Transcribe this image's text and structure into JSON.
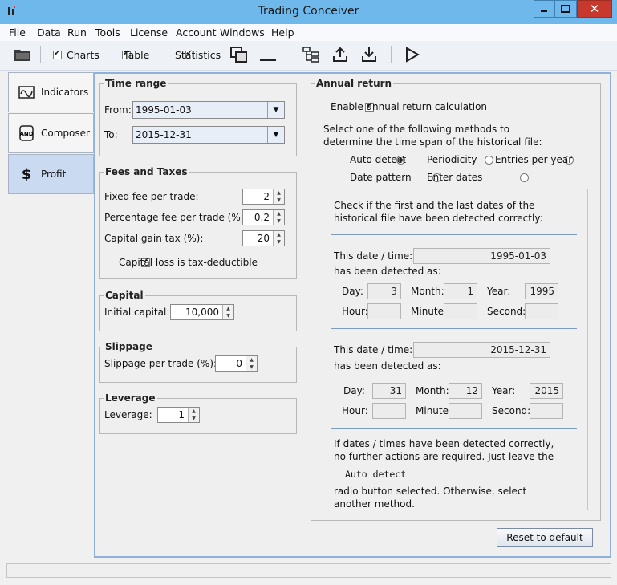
{
  "window": {
    "title": "Trading Conceiver",
    "minimize": "▁",
    "maximize": "□",
    "close": "✕"
  },
  "menu": [
    "File",
    "Data",
    "Run",
    "Tools",
    "License",
    "Account",
    "Windows",
    "Help"
  ],
  "toolbar": {
    "charts_label": "Charts",
    "table_label": "Table",
    "statistics_label": "Statistics",
    "charts_checked": true,
    "table_checked": true,
    "statistics_checked": true,
    "icons": [
      "folder-icon",
      "copy-windows-icon",
      "minimize-line-icon",
      "tree-icon",
      "upload-icon",
      "download-icon",
      "play-icon"
    ]
  },
  "tabs": [
    {
      "label": "Indicators",
      "icon": "wave-icon",
      "active": false
    },
    {
      "label": "Composer",
      "icon": "and-gate-icon",
      "active": false
    },
    {
      "label": "Profit",
      "icon": "dollar-icon",
      "active": true
    }
  ],
  "time_range": {
    "legend": "Time range",
    "from_label": "From:",
    "from_value": "1995-01-03",
    "to_label": "To:",
    "to_value": "2015-12-31"
  },
  "fees": {
    "legend": "Fees and Taxes",
    "fixed_label": "Fixed fee per trade:",
    "fixed_value": "2",
    "percent_label": "Percentage fee per trade (%):",
    "percent_value": "0.2",
    "cgt_label": "Capital gain tax (%):",
    "cgt_value": "20",
    "loss_label": "Capital loss is tax-deductible",
    "loss_checked": true
  },
  "capital": {
    "legend": "Capital",
    "label": "Initial capital:",
    "value": "10,000"
  },
  "slippage": {
    "legend": "Slippage",
    "label": "Slippage per trade (%):",
    "value": "0"
  },
  "leverage": {
    "legend": "Leverage",
    "label": "Leverage:",
    "value": "1"
  },
  "annual": {
    "legend": "Annual return",
    "enable_label": "Enable annual return calculation",
    "enable_checked": true,
    "methods_line1": "Select one of the following methods to",
    "methods_line2": "determine the time span of the historical file:",
    "radio_auto": "Auto detect",
    "radio_periodicity": "Periodicity",
    "radio_entries": "Entries per year",
    "radio_pattern": "Date pattern",
    "radio_enter": "Enter dates",
    "selected": "Auto detect",
    "check_line1": "Check if the first and the last dates of the",
    "check_line2": "historical file have been detected correctly:",
    "first": {
      "date_label": "This date / time:",
      "date_value": "1995-01-03",
      "detected_label": "has been detected as:",
      "day_label": "Day:",
      "day": "3",
      "month_label": "Month:",
      "month": "1",
      "year_label": "Year:",
      "year": "1995",
      "hour_label": "Hour:",
      "hour": "",
      "minute_label": "Minute:",
      "minute": "",
      "second_label": "Second:",
      "second": ""
    },
    "last": {
      "date_label": "This date / time:",
      "date_value": "2015-12-31",
      "detected_label": "has been detected as:",
      "day_label": "Day:",
      "day": "31",
      "month_label": "Month:",
      "month": "12",
      "year_label": "Year:",
      "year": "2015",
      "hour_label": "Hour:",
      "hour": "",
      "minute_label": "Minute:",
      "minute": "",
      "second_label": "Second:",
      "second": ""
    },
    "note_line1": "If dates / times have been detected correctly,",
    "note_line2": "no further actions are required. Just leave the",
    "note_code": "Auto detect",
    "note_line3": "radio button selected. Otherwise, select",
    "note_line4": "another method."
  },
  "reset_label": "Reset to default"
}
